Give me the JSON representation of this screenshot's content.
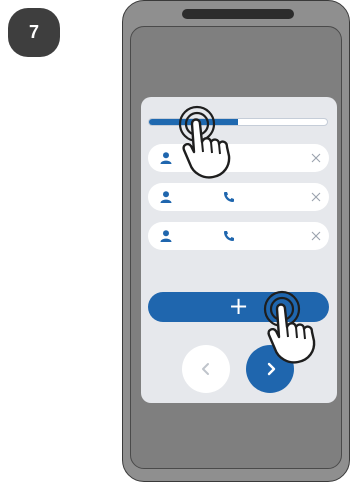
{
  "step": {
    "number": "7"
  },
  "progress": {
    "fraction": 0.5
  },
  "contacts": [
    {
      "person_icon": "person-icon",
      "phone_icon": "",
      "remove_icon": "close-icon"
    },
    {
      "person_icon": "person-icon",
      "phone_icon": "phone-icon",
      "remove_icon": "close-icon"
    },
    {
      "person_icon": "person-icon",
      "phone_icon": "phone-icon",
      "remove_icon": "close-icon"
    }
  ],
  "actions": {
    "add_label": "+",
    "back_icon": "chevron-left-icon",
    "next_icon": "chevron-right-icon"
  },
  "gestures": {
    "hand_icon": "pointing-hand-tap-icon"
  },
  "colors": {
    "accent": "#1f66ae",
    "phone_body": "#8f8f8f",
    "panel": "#e6e8ec",
    "badge": "#3e3e3e"
  }
}
